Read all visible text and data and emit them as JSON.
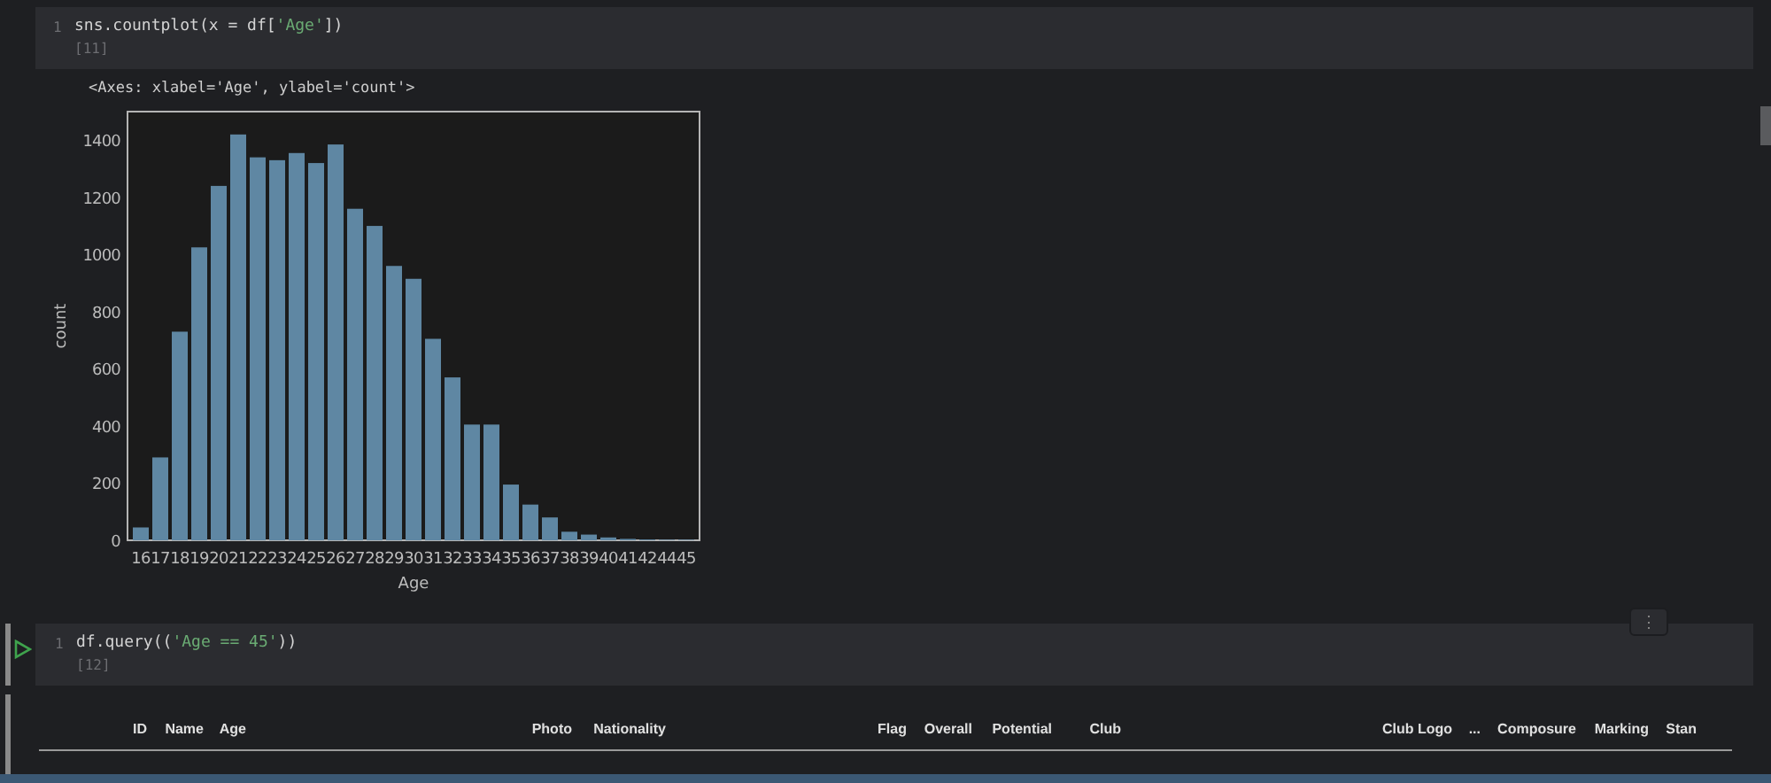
{
  "cells": [
    {
      "line_number": "1",
      "code_parts": [
        {
          "text": "sns.countplot(x = df[",
          "kind": "plain"
        },
        {
          "text": "'Age'",
          "kind": "string"
        },
        {
          "text": "])",
          "kind": "plain"
        }
      ],
      "exec_count": "[11]",
      "running": false,
      "output_text": "<Axes: xlabel='Age', ylabel='count'>",
      "chart_data": {
        "type": "bar",
        "xlabel": "Age",
        "ylabel": "count",
        "categories": [
          "16",
          "17",
          "18",
          "19",
          "20",
          "21",
          "22",
          "23",
          "24",
          "25",
          "26",
          "27",
          "28",
          "29",
          "30",
          "31",
          "32",
          "33",
          "34",
          "35",
          "36",
          "37",
          "38",
          "39",
          "40",
          "41",
          "42",
          "44",
          "45"
        ],
        "series": [
          {
            "color": "#5f87a3",
            "values": [
              45,
              290,
              730,
              1025,
              1240,
              1420,
              1340,
              1330,
              1355,
              1320,
              1385,
              1160,
              1100,
              960,
              915,
              705,
              570,
              405,
              405,
              195,
              125,
              80,
              30,
              20,
              10,
              5,
              3,
              2,
              2
            ]
          }
        ],
        "ylim": [
          0,
          1500
        ],
        "yticks": [
          0,
          200,
          400,
          600,
          800,
          1000,
          1200,
          1400
        ]
      }
    },
    {
      "line_number": "1",
      "code_parts": [
        {
          "text": "df.query((",
          "kind": "plain"
        },
        {
          "text": "'Age == 45'",
          "kind": "string"
        },
        {
          "text": "))",
          "kind": "plain"
        }
      ],
      "exec_count": "[12]",
      "running": true,
      "more_button": "⋮",
      "table_columns": [
        "ID",
        "Name",
        "Age",
        "Photo",
        "Nationality",
        "Flag",
        "Overall",
        "Potential",
        "Club",
        "Club Logo",
        "...",
        "Composure",
        "Marking",
        "Stan"
      ]
    }
  ]
}
